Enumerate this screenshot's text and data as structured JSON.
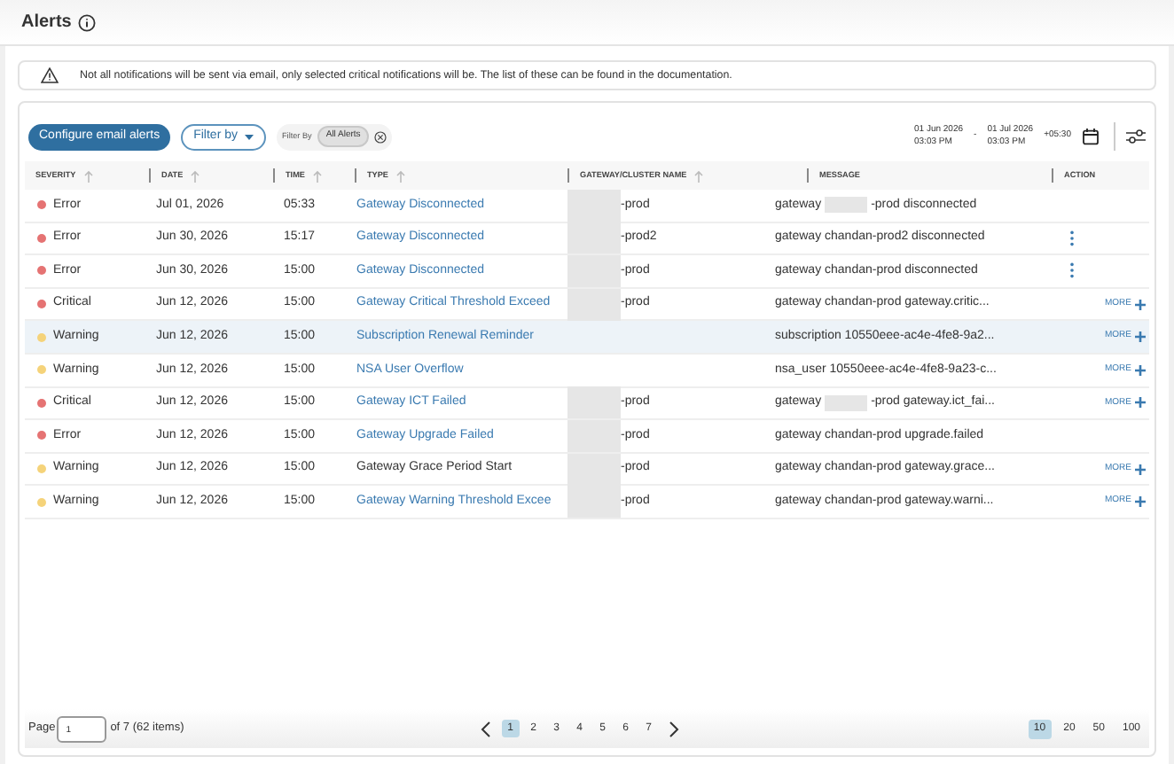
{
  "header": {
    "title": "Alerts"
  },
  "notice": {
    "text": "Not all notifications will be sent via email, only selected critical notifications will be. The list of these can be found in the documentation."
  },
  "toolbar": {
    "configure_button": "Configure email alerts",
    "filter_button": "Filter by",
    "filter_label": "Filter By",
    "filter_chip": "All Alerts",
    "date_from": "01 Jun 2026",
    "time_from": "03:03 PM",
    "date_sep": "-",
    "date_to": "01 Jul 2026",
    "time_to": "03:03 PM",
    "timezone": "+05:30"
  },
  "table": {
    "columns": [
      {
        "label": "SEVERITY",
        "sortable": true
      },
      {
        "label": "DATE",
        "sortable": true
      },
      {
        "label": "TIME",
        "sortable": true
      },
      {
        "label": "TYPE",
        "sortable": true
      },
      {
        "label": "GATEWAY/CLUSTER NAME",
        "sortable": true
      },
      {
        "label": "MESSAGE",
        "sortable": false
      },
      {
        "label": "ACTION",
        "sortable": false
      }
    ],
    "rows": [
      {
        "kind": "plain",
        "severity": "Error",
        "color": "#e57373",
        "date": "Jul 01, 2026",
        "time": "05:33",
        "type": "Gateway Disconnected",
        "type_link": true,
        "gateway": "-prod",
        "message": [
          "gateway",
          "-prod disconnected"
        ],
        "hovered": false
      },
      {
        "kind": "menu",
        "severity": "Error",
        "color": "#e57373",
        "date": "Jun 30, 2026",
        "time": "15:17",
        "type": "Gateway Disconnected",
        "type_link": true,
        "gateway": "-prod2",
        "message": [
          "gateway chandan-prod2 disconnected"
        ],
        "hovered": false
      },
      {
        "kind": "menu",
        "severity": "Error",
        "color": "#e57373",
        "date": "Jun 30, 2026",
        "time": "15:00",
        "type": "Gateway Disconnected",
        "type_link": true,
        "gateway": "-prod",
        "message": [
          "gateway chandan-prod disconnected"
        ],
        "hovered": false
      },
      {
        "kind": "more",
        "severity": "Critical",
        "color": "#e57373",
        "date": "Jun 12, 2026",
        "time": "15:00",
        "type": "Gateway Critical Threshold Exceed",
        "type_link": true,
        "gateway": "-prod",
        "message": [
          "gateway chandan-prod gateway.critic..."
        ],
        "more": "MORE",
        "hovered": false
      },
      {
        "kind": "more",
        "severity": "Warning",
        "color": "#f5d37a",
        "date": "Jun 12, 2026",
        "time": "15:00",
        "type": "Subscription Renewal Reminder",
        "type_link": true,
        "message": [
          "subscription 10550eee-ac4e-4fe8-9a2..."
        ],
        "more": "MORE",
        "hovered": true
      },
      {
        "kind": "more",
        "severity": "Warning",
        "color": "#f5d37a",
        "date": "Jun 12, 2026",
        "time": "15:00",
        "type": "NSA User Overflow",
        "type_link": true,
        "message": [
          "nsa_user 10550eee-ac4e-4fe8-9a23-c..."
        ],
        "more": "MORE",
        "hovered": false
      },
      {
        "kind": "more",
        "severity": "Critical",
        "color": "#e57373",
        "date": "Jun 12, 2026",
        "time": "15:00",
        "type": "Gateway ICT Failed",
        "type_link": true,
        "gateway": "-prod",
        "message": [
          "gateway",
          "-prod gateway.ict_fai..."
        ],
        "more": "MORE",
        "hovered": false
      },
      {
        "kind": "plain",
        "severity": "Error",
        "color": "#e57373",
        "date": "Jun 12, 2026",
        "time": "15:00",
        "type": "Gateway Upgrade Failed",
        "type_link": true,
        "gateway": "-prod",
        "message": [
          "gateway chandan-prod upgrade.failed"
        ],
        "hovered": false
      },
      {
        "kind": "more",
        "severity": "Warning",
        "color": "#f5d37a",
        "date": "Jun 12, 2026",
        "time": "15:00",
        "type": "Gateway Grace Period Start",
        "type_link": false,
        "gateway": "-prod",
        "message": [
          "gateway chandan-prod gateway.grace..."
        ],
        "more": "MORE",
        "hovered": false
      },
      {
        "kind": "more",
        "severity": "Warning",
        "color": "#f5d37a",
        "date": "Jun 12, 2026",
        "time": "15:00",
        "type": "Gateway Warning Threshold Excee",
        "type_link": true,
        "gateway": "-prod",
        "message": [
          "gateway chandan-prod gateway.warni..."
        ],
        "more": "MORE",
        "hovered": false
      }
    ]
  },
  "pagination": {
    "page_label": "Page",
    "page_value": "1",
    "page_total": "of 7 (62 items)",
    "pages": [
      {
        "label": "1",
        "selected": true
      },
      {
        "label": "2",
        "selected": false
      },
      {
        "label": "3",
        "selected": false
      },
      {
        "label": "4",
        "selected": false
      },
      {
        "label": "5",
        "selected": false
      },
      {
        "label": "6",
        "selected": false
      },
      {
        "label": "7",
        "selected": false
      }
    ],
    "sizes": [
      {
        "label": "10",
        "selected": true
      },
      {
        "label": "20",
        "selected": false
      },
      {
        "label": "50",
        "selected": false
      },
      {
        "label": "100",
        "selected": false
      }
    ]
  }
}
